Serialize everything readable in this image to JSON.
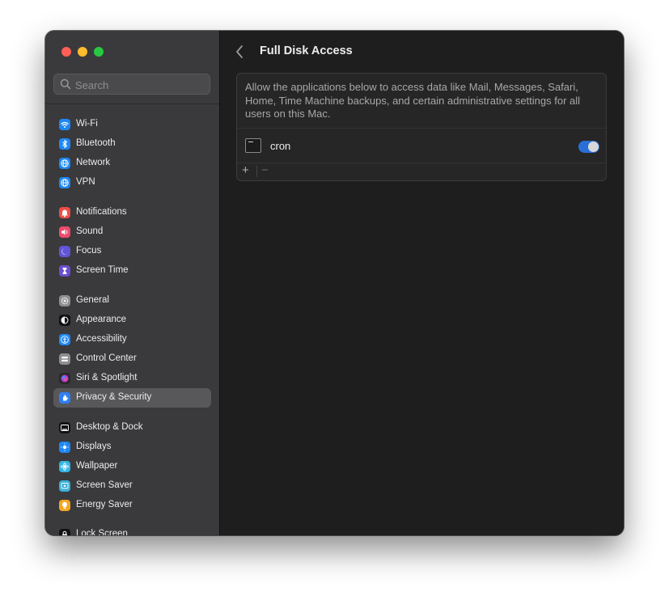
{
  "window": {
    "title": "Full Disk Access"
  },
  "search": {
    "placeholder": "Search"
  },
  "sidebar": {
    "items": [
      {
        "label": "Wi-Fi",
        "color": "#1e88f5"
      },
      {
        "label": "Bluetooth",
        "color": "#1e88f5"
      },
      {
        "label": "Network",
        "color": "#1e88f5"
      },
      {
        "label": "VPN",
        "color": "#1e88f5"
      },
      {
        "label": "Notifications",
        "color": "#ec4c47"
      },
      {
        "label": "Sound",
        "color": "#ec4c6b"
      },
      {
        "label": "Focus",
        "color": "#6254d6"
      },
      {
        "label": "Screen Time",
        "color": "#6a4fcf"
      },
      {
        "label": "General",
        "color": "#8e8e93"
      },
      {
        "label": "Appearance",
        "color": "#111111"
      },
      {
        "label": "Accessibility",
        "color": "#1e88f5"
      },
      {
        "label": "Control Center",
        "color": "#8e8e93"
      },
      {
        "label": "Siri & Spotlight",
        "color": "#c13ad6"
      },
      {
        "label": "Privacy & Security",
        "color": "#2f7ef5"
      },
      {
        "label": "Desktop & Dock",
        "color": "#111111"
      },
      {
        "label": "Displays",
        "color": "#1e88f5"
      },
      {
        "label": "Wallpaper",
        "color": "#35b5e6"
      },
      {
        "label": "Screen Saver",
        "color": "#3ab0d9"
      },
      {
        "label": "Energy Saver",
        "color": "#f5a623"
      },
      {
        "label": "Lock Screen",
        "color": "#111111"
      }
    ],
    "selected": "Privacy & Security"
  },
  "main": {
    "description": "Allow the applications below to access data like Mail, Messages, Safari, Home, Time Machine backups, and certain administrative settings for all users on this Mac.",
    "apps": [
      {
        "name": "cron",
        "enabled": true
      }
    ],
    "add_label": "+",
    "remove_label": "−"
  },
  "colors": {
    "accent": "#2a6fd6",
    "sidebar_bg": "#3a3a3c",
    "main_bg": "#1e1e1e"
  }
}
